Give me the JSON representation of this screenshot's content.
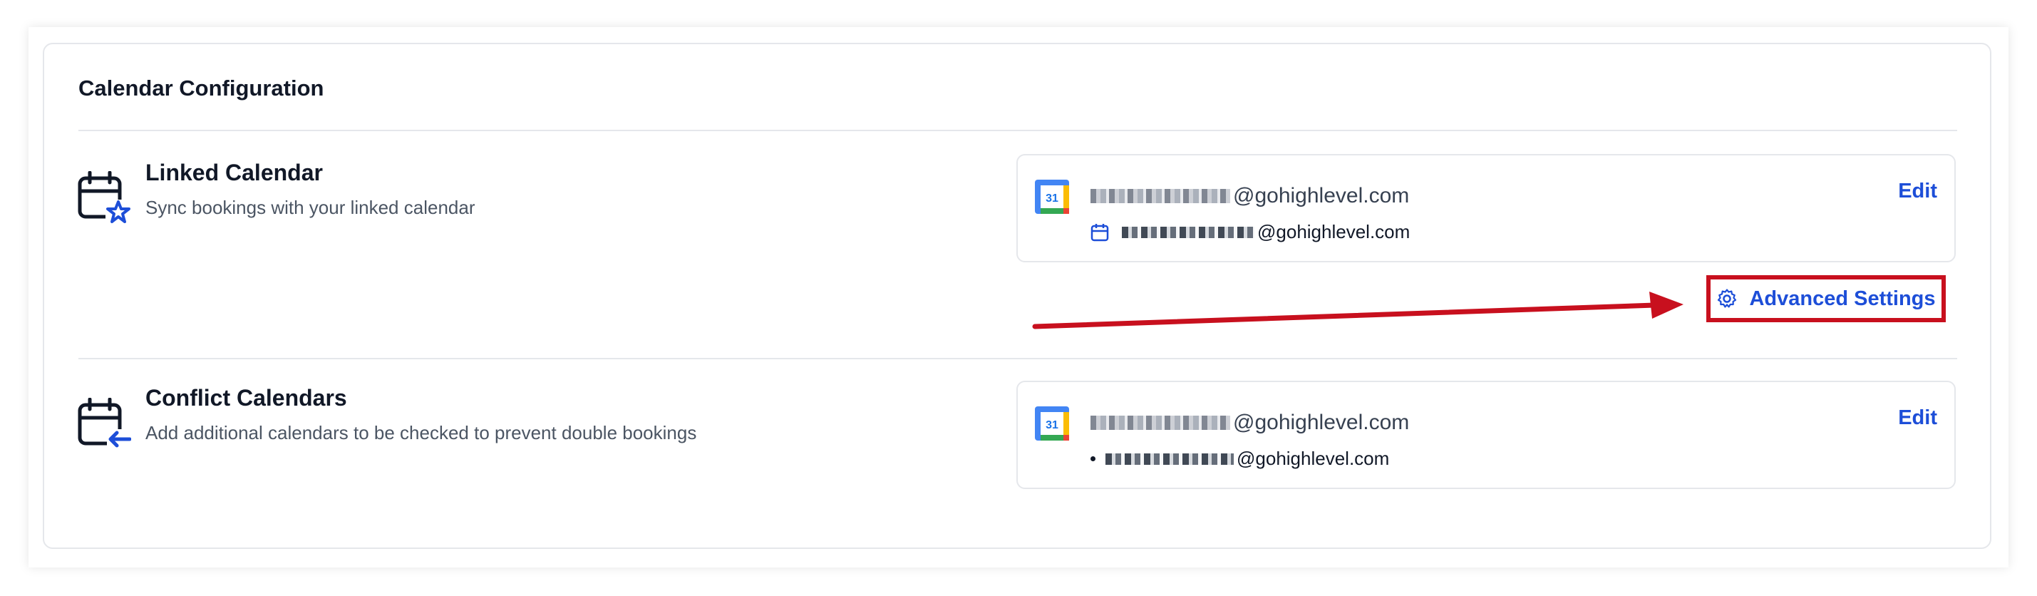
{
  "card_title": "Calendar Configuration",
  "linked": {
    "title": "Linked Calendar",
    "description": "Sync bookings with your linked calendar",
    "account_primary_domain": "@gohighlevel.com",
    "account_secondary_domain": "@gohighlevel.com",
    "edit_label": "Edit",
    "calendar_badge": "31"
  },
  "advanced_settings_label": "Advanced Settings",
  "conflict": {
    "title": "Conflict Calendars",
    "description": "Add additional calendars to be checked to prevent double bookings",
    "account_primary_domain": "@gohighlevel.com",
    "account_secondary_domain": "@gohighlevel.com",
    "edit_label": "Edit",
    "calendar_badge": "31"
  },
  "colors": {
    "accent": "#1d4ed8",
    "highlight": "#c8101e",
    "border": "#e5e7eb"
  },
  "icons": {
    "linked": "calendar-star-icon",
    "conflict": "calendar-arrow-left-icon",
    "provider": "google-calendar-icon",
    "settings": "gear-icon"
  }
}
